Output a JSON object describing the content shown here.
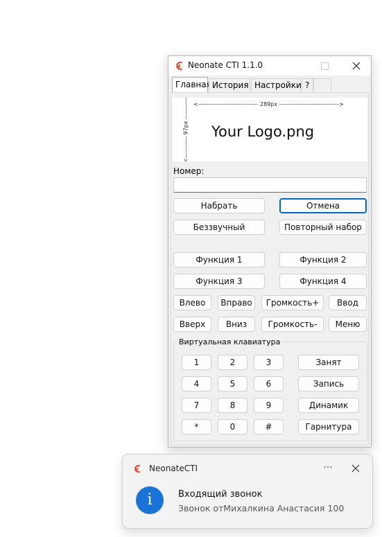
{
  "window": {
    "title": "Neonate CTI 1.1.0",
    "icons": {
      "app": "neonate-logo-icon",
      "minimize": "minimize-icon",
      "maximize": "maximize-icon",
      "close": "close-icon"
    }
  },
  "tabs": [
    {
      "label": "Главная",
      "active": true
    },
    {
      "label": "История",
      "active": false
    },
    {
      "label": "Настройки",
      "active": false
    },
    {
      "label": "?",
      "active": false
    }
  ],
  "logo": {
    "width_note": "<------------------------------ 289px ------------------------------>",
    "height_note": "<----------- 97px ----------->",
    "text": "Your Logo.png"
  },
  "number": {
    "label": "Номер:",
    "value": "",
    "placeholder": ""
  },
  "buttons": {
    "dial": "Набрать",
    "cancel": "Отмена",
    "mute": "Беззвучный",
    "redial": "Повторный набор",
    "func1": "Функция 1",
    "func2": "Функция 2",
    "func3": "Функция 3",
    "func4": "Функция 4",
    "left": "Влево",
    "right": "Вправо",
    "vol_up": "Громкость+",
    "enter": "Ввод",
    "up": "Вверх",
    "down": "Вниз",
    "vol_down": "Громкость-",
    "menu": "Меню"
  },
  "keypad": {
    "label": "Виртуальная клавиатура",
    "keys": [
      "1",
      "2",
      "3",
      "4",
      "5",
      "6",
      "7",
      "8",
      "9",
      "*",
      "0",
      "#"
    ],
    "side": {
      "busy": "Занят",
      "record": "Запись",
      "speaker": "Динамик",
      "headset": "Гарнитура"
    }
  },
  "toast": {
    "app": "NeonateCTI",
    "more": "···",
    "title": "Входящий звонок",
    "body": "Звонок отМихалкина Анастасия 100",
    "icon": "info-icon",
    "accent": "#1a73d6"
  }
}
